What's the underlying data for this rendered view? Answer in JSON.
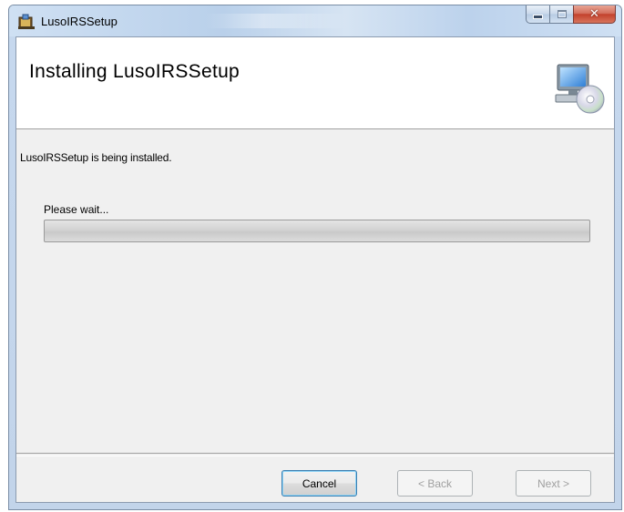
{
  "window": {
    "title": "LusoIRSSetup",
    "close_glyph": "✕",
    "colors": {
      "close": "#c3412c",
      "frame": "#c2d4ea"
    }
  },
  "banner": {
    "title": "Installing LusoIRSSetup",
    "icon": "computer-cd-icon"
  },
  "body": {
    "status": "LusoIRSSetup is being installed.",
    "wait": "Please wait...",
    "progress": 0
  },
  "buttons": {
    "cancel": "Cancel",
    "back": "< Back",
    "next": "Next >"
  }
}
